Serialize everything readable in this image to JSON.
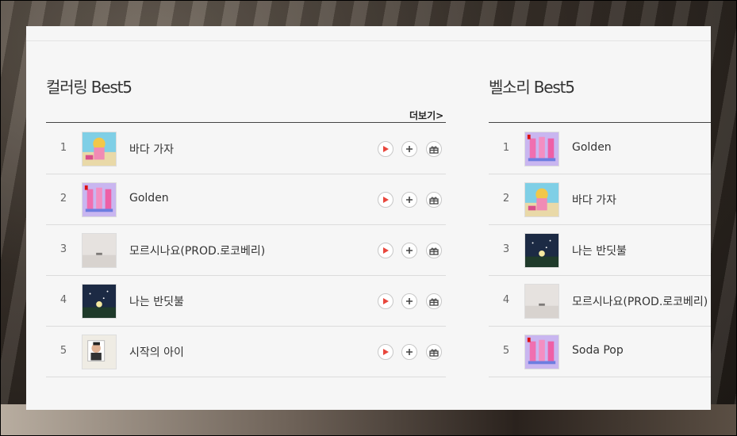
{
  "sections": [
    {
      "title": "컬러링 Best5",
      "more": "더보기>",
      "items": [
        {
          "rank": "1",
          "title": "바다 가자",
          "art": "beach-art"
        },
        {
          "rank": "2",
          "title": "Golden",
          "art": "pink-art"
        },
        {
          "rank": "3",
          "title": "모르시나요(PROD.로코베리)",
          "art": "mist-art"
        },
        {
          "rank": "4",
          "title": "나는 반딧불",
          "art": "night-art"
        },
        {
          "rank": "5",
          "title": "시작의 아이",
          "art": "portrait-art"
        }
      ]
    },
    {
      "title": "벨소리 Best5",
      "items": [
        {
          "rank": "1",
          "title": "Golden",
          "art": "pink-art"
        },
        {
          "rank": "2",
          "title": "바다 가자",
          "art": "beach-art"
        },
        {
          "rank": "3",
          "title": "나는 반딧불",
          "art": "night-art"
        },
        {
          "rank": "4",
          "title": "모르시나요(PROD.로코베리)",
          "art": "mist-art"
        },
        {
          "rank": "5",
          "title": "Soda Pop",
          "art": "pink-art"
        }
      ]
    }
  ],
  "colors": {
    "play": "#e8463c",
    "accent_border": "#c8c8c8"
  },
  "icons": [
    "play-icon",
    "plus-icon",
    "gift-icon"
  ]
}
